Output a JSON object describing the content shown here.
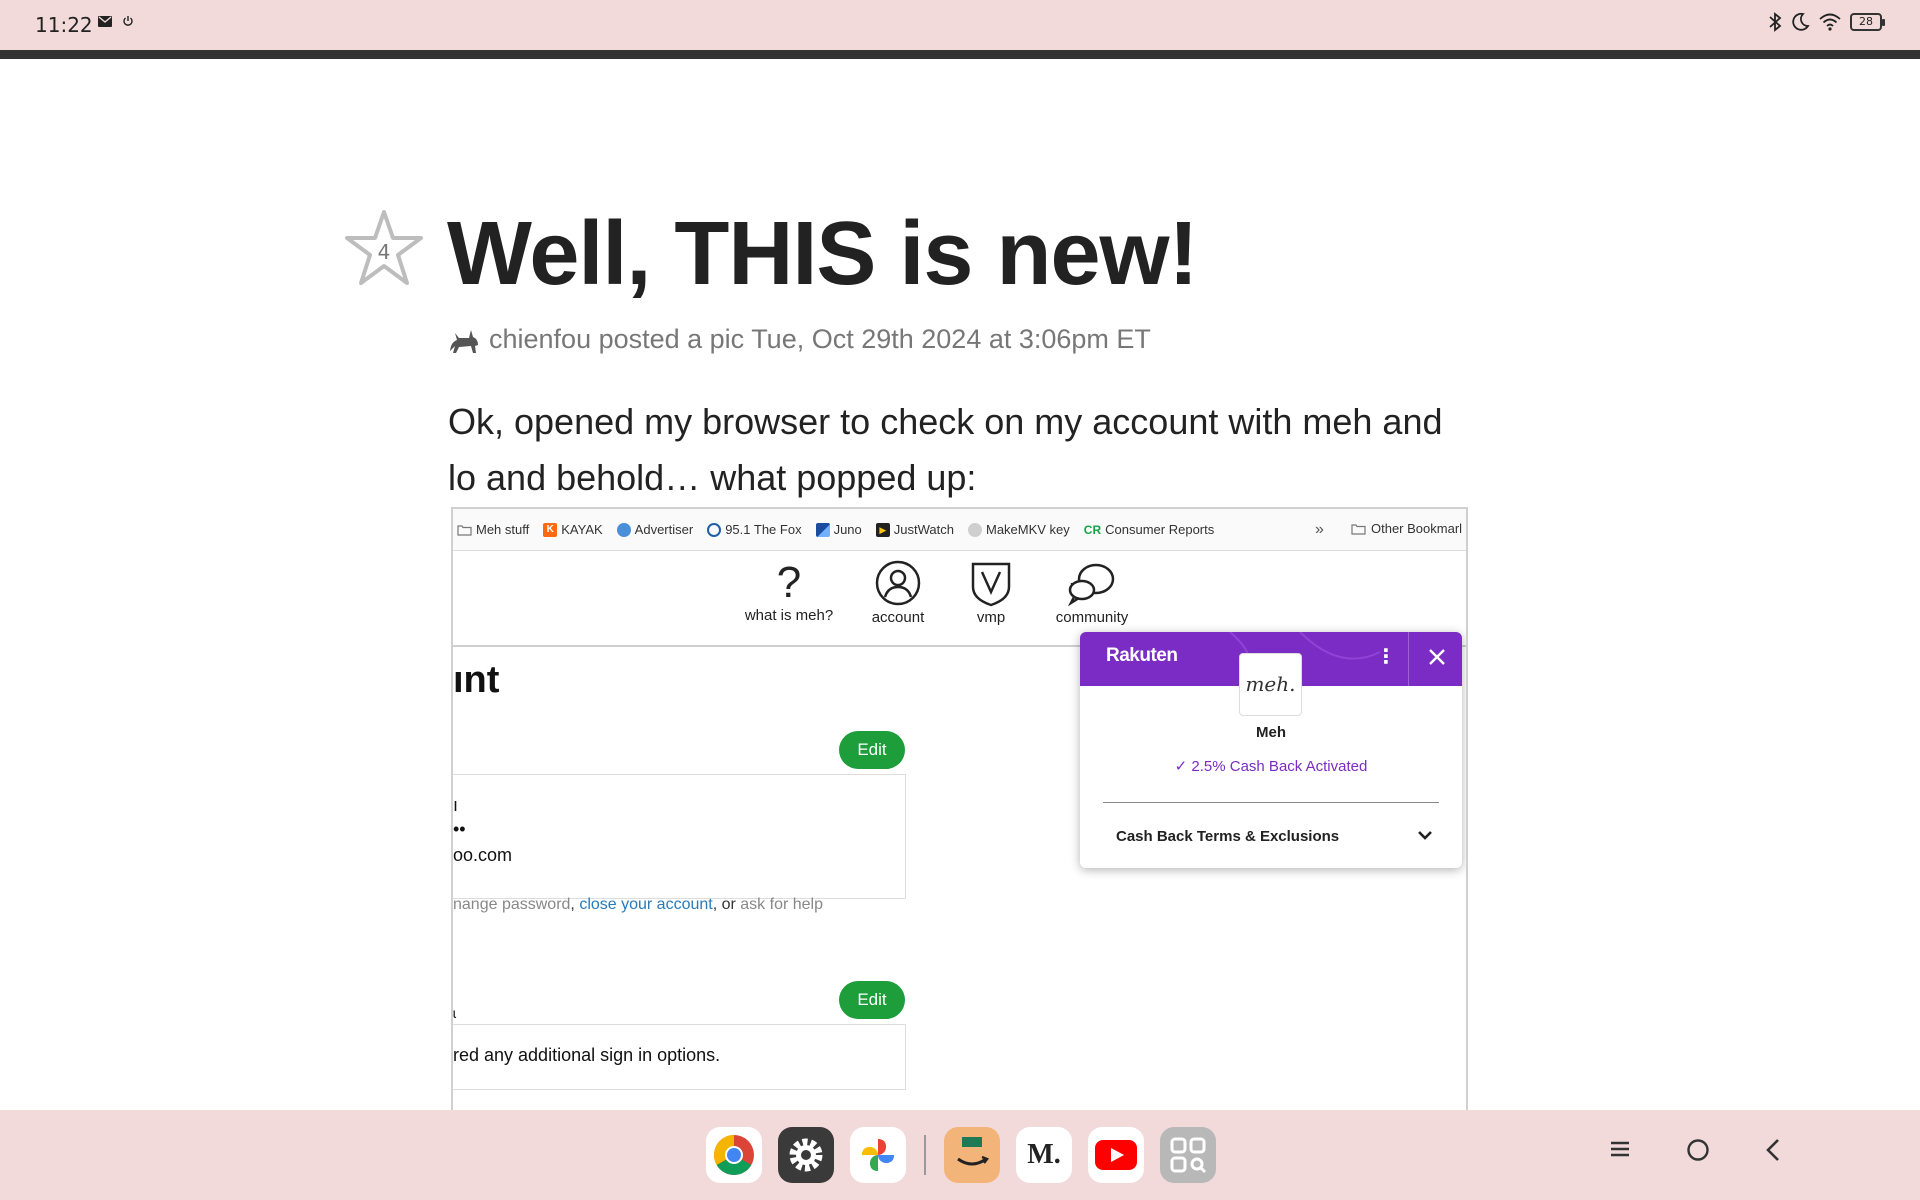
{
  "status_bar": {
    "time": "11:22",
    "battery": "28"
  },
  "post": {
    "star_count": "4",
    "title": "Well, THIS is new!",
    "meta": "chienfou posted a pic Tue, Oct 29th 2024 at 3:06pm ET",
    "body": "Ok, opened my browser to check on my account with meh and lo and behold… what popped up:"
  },
  "screenshot": {
    "bookmarks": [
      {
        "label": "Meh stuff",
        "icon": "folder-icon",
        "color": "#777777"
      },
      {
        "label": "KAYAK",
        "icon": "kayak-icon",
        "color": "#ff690f"
      },
      {
        "label": "Advertiser",
        "icon": "advertiser-icon",
        "color": "#4a90d9"
      },
      {
        "label": "95.1 The Fox",
        "icon": "fox-icon",
        "color": "#1f5fa8"
      },
      {
        "label": "Juno",
        "icon": "juno-icon",
        "color": "#1b4d9c"
      },
      {
        "label": "JustWatch",
        "icon": "justwatch-icon",
        "color": "#222222"
      },
      {
        "label": "MakeMKV key",
        "icon": "makemkv-icon",
        "color": "#888888"
      },
      {
        "label": "Consumer Reports",
        "icon": "cr-icon",
        "color": "#19a34a"
      }
    ],
    "other_bookmarks": "Other Bookmarl",
    "nav": {
      "what_is_meh": "what is meh?",
      "account": "account",
      "vmp": "vmp",
      "community": "community"
    },
    "account_heading": "ınt",
    "edit_label": "Edit",
    "card1_lines": [
      "ı",
      "••",
      "oo.com"
    ],
    "links": {
      "change_password": "nange password",
      "sep1": ", ",
      "close_account": "close your account",
      "sep2": ", or ",
      "ask_help": "ask for help"
    },
    "card2_prefix": "ɩ",
    "card2_text": "red any additional sign in options."
  },
  "rakuten": {
    "brand": "Rakuten",
    "store_logo": "meh.",
    "store_name": "Meh",
    "cashback": "✓ 2.5% Cash Back Activated",
    "terms": "Cash Back Terms & Exclusions",
    "brand_color": "#7b2cc4"
  },
  "dock": {
    "apps": [
      "chrome-icon",
      "settings-icon",
      "photos-icon",
      "amazon-icon",
      "medium-icon",
      "youtube-icon",
      "app-drawer-icon"
    ],
    "medium_label": "M."
  }
}
